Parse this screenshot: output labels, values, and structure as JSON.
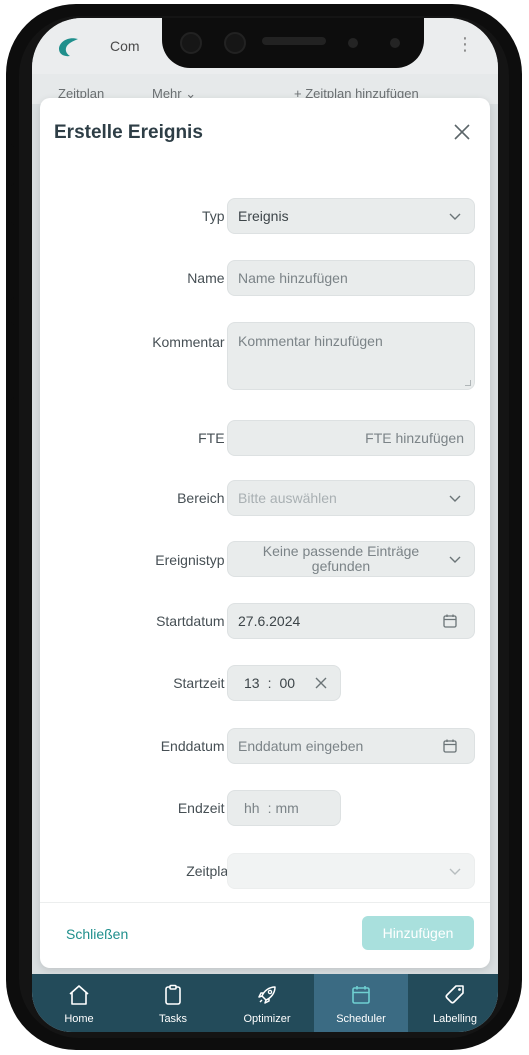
{
  "app": {
    "title_partial": "Com",
    "subtabs": [
      "Zeitplan",
      "Mehr ⌄",
      "+ Zeitplan hinzufügen"
    ]
  },
  "modal": {
    "title": "Erstelle Ereignis",
    "fields": {
      "typ": {
        "label": "Typ",
        "required": "*",
        "value": "Ereignis"
      },
      "name": {
        "label": "Name",
        "required": "*",
        "placeholder": "Name hinzufügen"
      },
      "kommentar": {
        "label": "Kommentar",
        "required": "*",
        "placeholder": "Kommentar hinzufügen"
      },
      "fte": {
        "label": "FTE",
        "required": "*",
        "placeholder": "FTE hinzufügen"
      },
      "bereich": {
        "label": "Bereich",
        "required": "*",
        "placeholder": "Bitte auswählen"
      },
      "ereignistyp": {
        "label": "Ereignistyp",
        "required": "*",
        "value": "Keine passende Einträge gefunden"
      },
      "startdatum": {
        "label": "Startdatum",
        "required": "*",
        "value": "27.6.2024"
      },
      "startzeit": {
        "label": "Startzeit",
        "required": "*",
        "hours": "13",
        "sep": ":",
        "minutes": "00"
      },
      "enddatum": {
        "label": "Enddatum",
        "required": "*",
        "placeholder": "Enddatum eingeben"
      },
      "endzeit": {
        "label": "Endzeit",
        "required": "*",
        "hours": "hh",
        "sep": ":",
        "minutes": "mm"
      },
      "zeitplan": {
        "label": "Zeitplan",
        "value": ""
      }
    },
    "footer": {
      "close_label": "Schließen",
      "add_label": "Hinzufügen"
    }
  },
  "bottom_nav": {
    "items": [
      {
        "label": "Home",
        "icon": "home-icon"
      },
      {
        "label": "Tasks",
        "icon": "clipboard-icon"
      },
      {
        "label": "Optimizer",
        "icon": "rocket-icon"
      },
      {
        "label": "Scheduler",
        "icon": "calendar-icon",
        "active": true
      },
      {
        "label": "Labelling",
        "icon": "tag-icon"
      }
    ]
  },
  "colors": {
    "accent": "#1f8f8c",
    "nav_bg": "#234b5a",
    "nav_active": "#3b6b83",
    "add_btn": "#a9e0dd"
  }
}
